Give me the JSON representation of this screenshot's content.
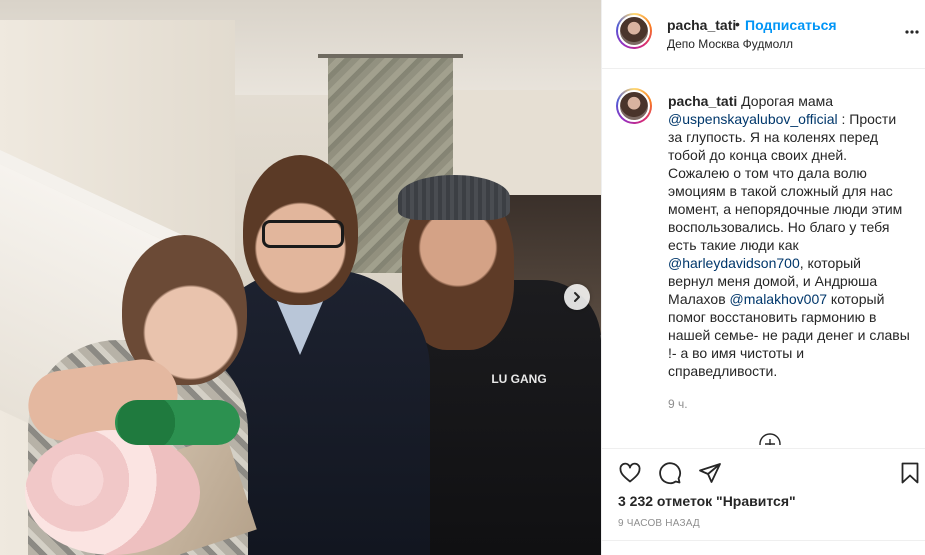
{
  "post": {
    "photo_print_text": "LU GANG"
  },
  "header": {
    "username": "pacha_tati",
    "separator": "•",
    "follow_label": "Подписаться",
    "location": "Депо Москва Фудмолл"
  },
  "caption": {
    "username": "pacha_tati",
    "parts": [
      {
        "t": " Дорогая мама "
      },
      {
        "m": "@uspenskayalubov_official"
      },
      {
        "t": " : Прости за глупость. Я на коленях перед тобой до конца своих дней. Сожалею о том что дала волю эмоциям в такой сложный для нас момент, а непорядочные люди этим воспользовались. Но благо у тебя есть такие люди как "
      },
      {
        "m": "@harleydavidson700"
      },
      {
        "t": ", который вернул меня домой, и Андрюша Малахов "
      },
      {
        "m": "@malakhov007"
      },
      {
        "t": " который помог восстановить гармонию в нашей семье- не ради денег и славы !- а во имя чистоты и справедливости."
      }
    ],
    "time": "9 ч."
  },
  "footer": {
    "likes": "3 232 отметок \"Нравится\"",
    "date": "9 ЧАСОВ НАЗАД"
  },
  "icons": {
    "more": "more-options-icon",
    "next": "chevron-right-icon",
    "load_more": "plus-circle-icon",
    "like": "heart-icon",
    "comment": "comment-icon",
    "share": "send-icon",
    "save": "bookmark-icon"
  },
  "colors": {
    "accent": "#0095f6",
    "mention": "#00376b",
    "muted": "#8e8e8e"
  }
}
